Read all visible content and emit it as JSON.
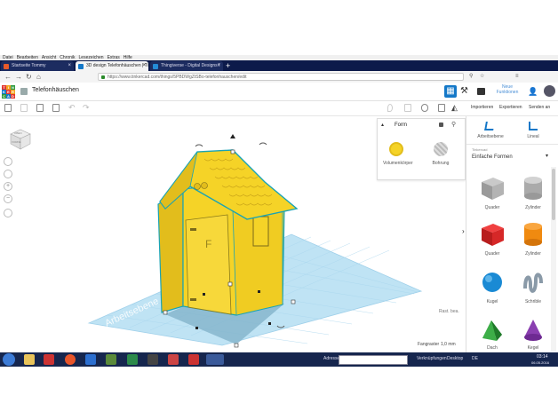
{
  "browser": {
    "menu": [
      "Datei",
      "Bearbeiten",
      "Ansicht",
      "Chronik",
      "Lesezeichen",
      "Extras",
      "Hilfe"
    ],
    "tabs": [
      {
        "label": "Startseite Tommy",
        "active": false
      },
      {
        "label": "3D design Telefonhäuschen | Ti",
        "active": true
      },
      {
        "label": "Thingiverse - Digital Designs f",
        "active": false
      }
    ],
    "new_tab": "+",
    "url": "https://www.tinkercad.com/things/5PBDWgZtSBo-telefonhauschen/edit"
  },
  "app": {
    "logo_letters": [
      "T",
      "I",
      "N",
      "K",
      "E",
      "R",
      "C",
      "A",
      "D"
    ],
    "title": "Telefonhäuschen",
    "new_shapes_label": "Neue Funktionen",
    "actions": {
      "import": "Importieren",
      "export": "Exportieren",
      "send": "Senden an"
    }
  },
  "form_panel": {
    "title": "Form",
    "solid_label": "Volumenkörper",
    "hole_label": "Bohrung"
  },
  "right_panel": {
    "workplane_label": "Arbeitsebene",
    "ruler_label": "Lineal",
    "library_header": "Tinkercad",
    "library_selected": "Einfache Formen",
    "shapes": [
      {
        "label": "Quader",
        "icon": "box-gray-icon"
      },
      {
        "label": "Zylinder",
        "icon": "cylinder-gray-icon"
      },
      {
        "label": "Quader",
        "icon": "box-red-icon"
      },
      {
        "label": "Zylinder",
        "icon": "cylinder-orange-icon"
      },
      {
        "label": "Kugel",
        "icon": "sphere-blue-icon"
      },
      {
        "label": "Schrible",
        "icon": "scribble-icon"
      },
      {
        "label": "Dach",
        "icon": "roof-green-icon"
      },
      {
        "label": "Kegel",
        "icon": "cone-purple-icon"
      }
    ]
  },
  "viewport": {
    "workplane_text": "Arbeitsebene",
    "snap_label": "Rast. bea.",
    "grid_label": "Fangraster",
    "grid_value": "1,0 mm",
    "view_cube_top": "OBEN",
    "view_cube_front": "VORNE"
  },
  "taskbar": {
    "address_label": "Adresse",
    "links_label": "Verknüpfungen",
    "desktop_label": "Desktop",
    "lang": "DE",
    "time": "03:14",
    "date": "06.05.2016"
  },
  "colors": {
    "house_yellow": "#f5d327",
    "outline_teal": "#19a3b5",
    "grid_blue": "#bfe3f4",
    "tinkercad_blue": "#1478c8"
  }
}
